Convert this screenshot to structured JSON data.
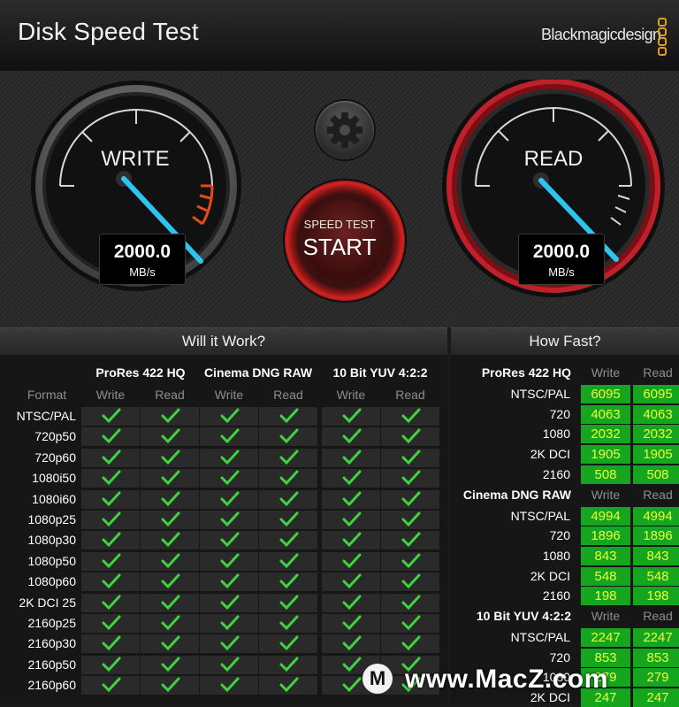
{
  "header": {
    "title": "Disk Speed Test",
    "brand": "Blackmagicdesign"
  },
  "gauges": {
    "write": {
      "label": "WRITE",
      "value": "2000.0",
      "unit": "MB/s"
    },
    "read": {
      "label": "READ",
      "value": "2000.0",
      "unit": "MB/s"
    }
  },
  "controls": {
    "settings_icon": "gear-icon",
    "start_small": "SPEED TEST",
    "start_big": "START"
  },
  "will_it_work": {
    "title": "Will it Work?",
    "format_label": "Format",
    "codecs": [
      "ProRes 422 HQ",
      "Cinema DNG RAW",
      "10 Bit YUV 4:2:2"
    ],
    "write_label": "Write",
    "read_label": "Read",
    "formats": [
      "NTSC/PAL",
      "720p50",
      "720p60",
      "1080i50",
      "1080i60",
      "1080p25",
      "1080p30",
      "1080p50",
      "1080p60",
      "2K DCI 25",
      "2160p25",
      "2160p30",
      "2160p50",
      "2160p60"
    ],
    "all_supported": true,
    "check_color": "#3fd43f"
  },
  "how_fast": {
    "title": "How Fast?",
    "write_label": "Write",
    "read_label": "Read",
    "groups": [
      {
        "name": "ProRes 422 HQ",
        "rows": [
          {
            "label": "NTSC/PAL",
            "write": "6095",
            "read": "6095"
          },
          {
            "label": "720",
            "write": "4063",
            "read": "4063"
          },
          {
            "label": "1080",
            "write": "2032",
            "read": "2032"
          },
          {
            "label": "2K DCI",
            "write": "1905",
            "read": "1905"
          },
          {
            "label": "2160",
            "write": "508",
            "read": "508"
          }
        ]
      },
      {
        "name": "Cinema DNG RAW",
        "rows": [
          {
            "label": "NTSC/PAL",
            "write": "4994",
            "read": "4994"
          },
          {
            "label": "720",
            "write": "1896",
            "read": "1896"
          },
          {
            "label": "1080",
            "write": "843",
            "read": "843"
          },
          {
            "label": "2K DCI",
            "write": "548",
            "read": "548"
          },
          {
            "label": "2160",
            "write": "198",
            "read": "198"
          }
        ]
      },
      {
        "name": "10 Bit YUV 4:2:2",
        "rows": [
          {
            "label": "NTSC/PAL",
            "write": "2247",
            "read": "2247"
          },
          {
            "label": "720",
            "write": "853",
            "read": "853"
          },
          {
            "label": "1080",
            "write": "279",
            "read": "279"
          },
          {
            "label": "2K DCI",
            "write": "247",
            "read": "247"
          }
        ]
      }
    ]
  },
  "watermark": {
    "text": "www.MacZ.com",
    "icon": "M"
  },
  "colors": {
    "accent_needle": "#2ec4f2",
    "read_ring": "#c0202a",
    "value_bg": "#16a51f",
    "value_text": "#e9ff3a"
  }
}
